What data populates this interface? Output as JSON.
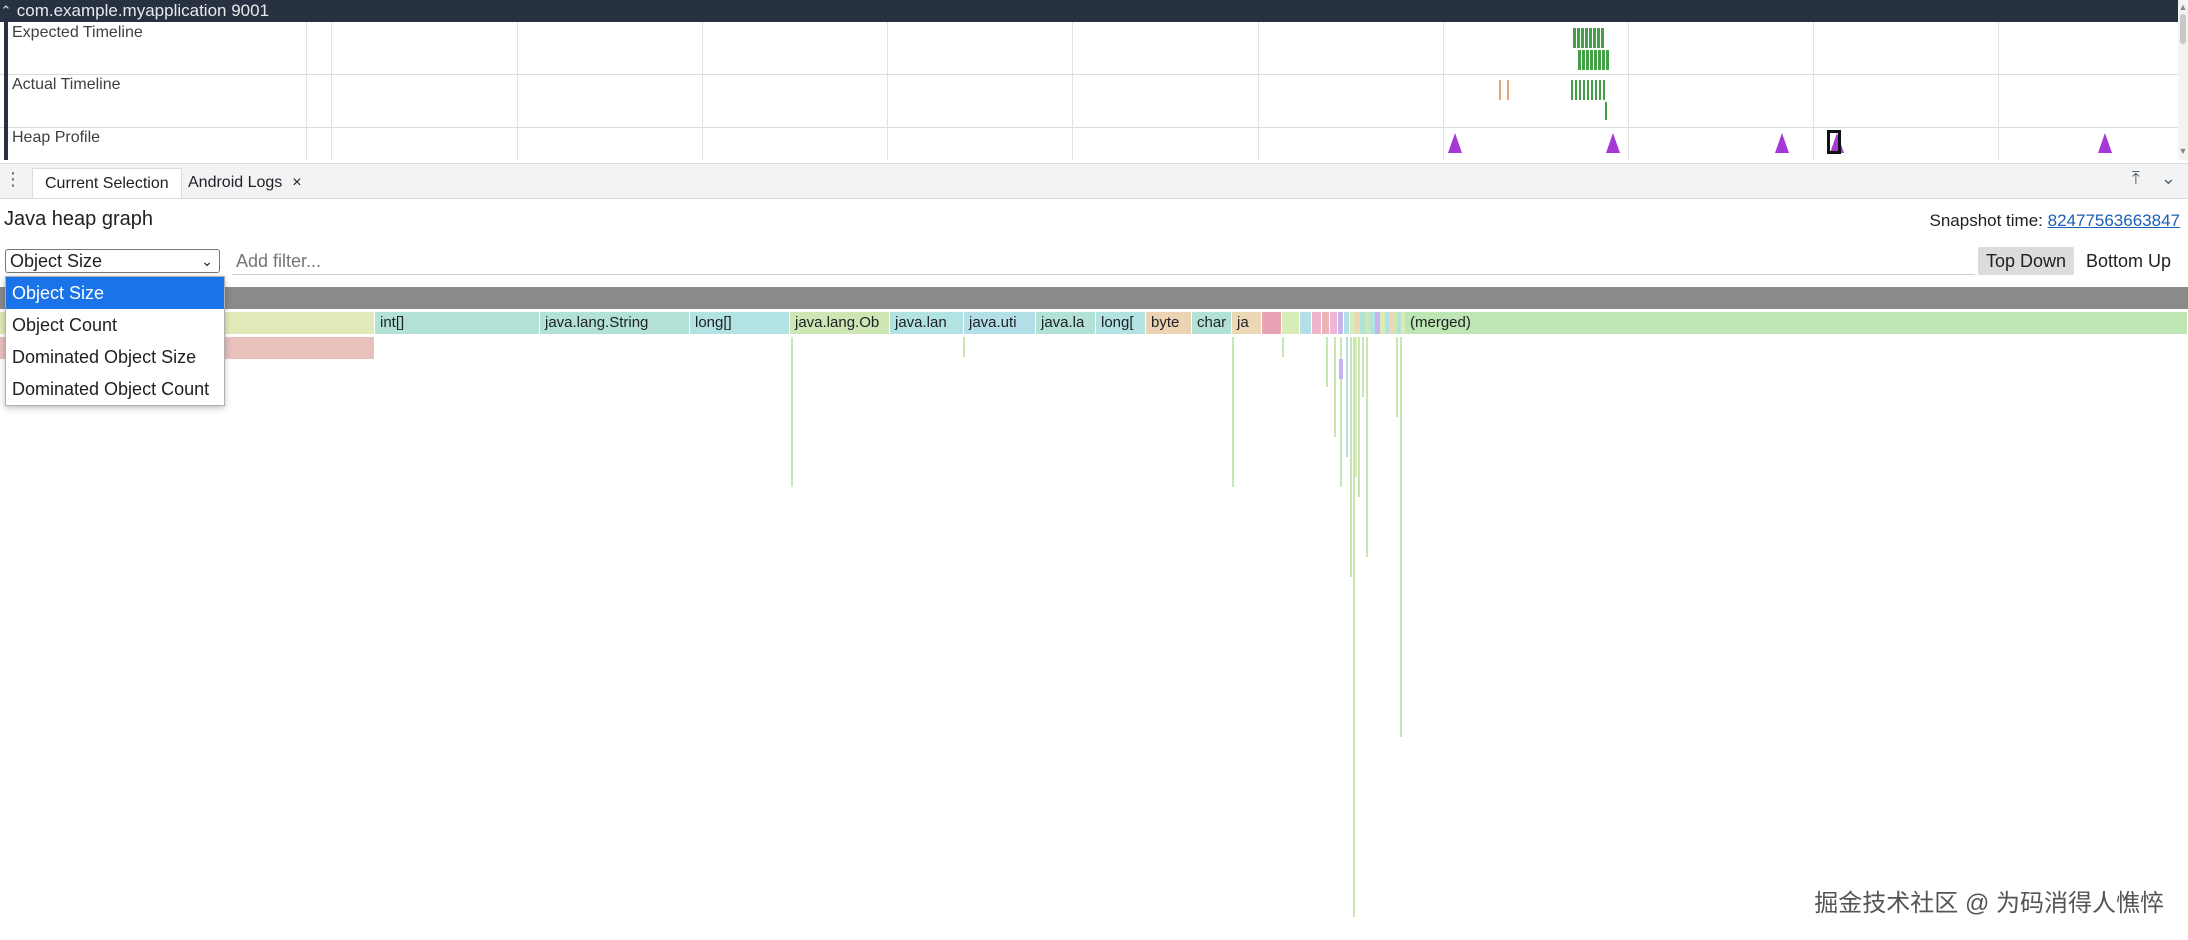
{
  "process": {
    "title": "com.example.myapplication 9001",
    "collapse_icon": "chevron-up-icon"
  },
  "tracks": [
    {
      "label": "Expected Timeline"
    },
    {
      "label": "Actual Timeline"
    },
    {
      "label": "Heap Profile"
    }
  ],
  "tabs": {
    "menu_icon": "kebab-menu-icon",
    "items": [
      {
        "label": "Current Selection",
        "active": true
      },
      {
        "label": "Android Logs",
        "active": false,
        "close": "×"
      }
    ],
    "tools": {
      "maximize": "⤒",
      "collapse": "⌄"
    }
  },
  "panel": {
    "title": "Java heap graph",
    "snapshot_label": "Snapshot time: ",
    "snapshot_value": "82477563663847"
  },
  "controls": {
    "metric_selected": "Object Size",
    "filter_placeholder": "Add filter...",
    "top_down": "Top Down",
    "bottom_up": "Bottom Up"
  },
  "dropdown": {
    "options": [
      "Object Size",
      "Object Count",
      "Dominated Object Size",
      "Dominated Object Count"
    ],
    "selected_index": 0
  },
  "flamegraph": {
    "nodes": [
      "int[]",
      "java.lang.String",
      "long[]",
      "java.lang.Ob",
      "java.lan",
      "java.uti",
      "java.la",
      "long[",
      "byte",
      "char",
      "ja",
      "(merged)"
    ]
  },
  "colors": {
    "header": "#273141",
    "accent": "#1a73e8",
    "heap_marker": "#a639d6",
    "expected": "#43a047"
  },
  "watermark": "掘金技术社区 @ 为码消得人憔悴"
}
